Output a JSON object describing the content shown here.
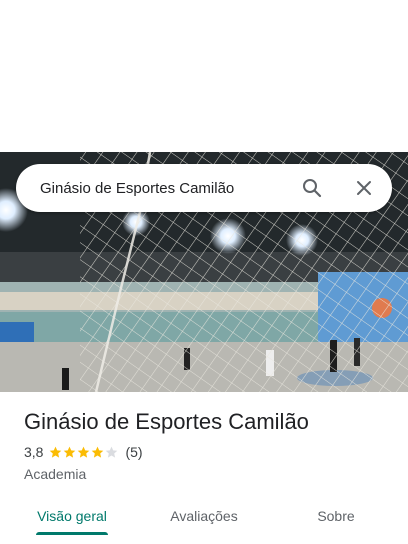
{
  "search": {
    "query": "Ginásio de Esportes Camilão",
    "search_icon": "search-icon",
    "close_icon": "close-icon"
  },
  "hero_photo": {
    "description_icon": "gym-photo"
  },
  "place": {
    "name": "Ginásio de Esportes Camilão",
    "rating": "3,8",
    "stars_filled": 4,
    "stars_total": 5,
    "review_count": "(5)",
    "category": "Academia",
    "star_color": "#fbbc04",
    "star_empty_color": "#dadce0"
  },
  "tabs": [
    {
      "label": "Visão geral",
      "active": true
    },
    {
      "label": "Avaliações",
      "active": false
    },
    {
      "label": "Sobre",
      "active": false
    }
  ],
  "colors": {
    "accent": "#00796b",
    "text_primary": "#202124",
    "text_secondary": "#5f6368"
  }
}
